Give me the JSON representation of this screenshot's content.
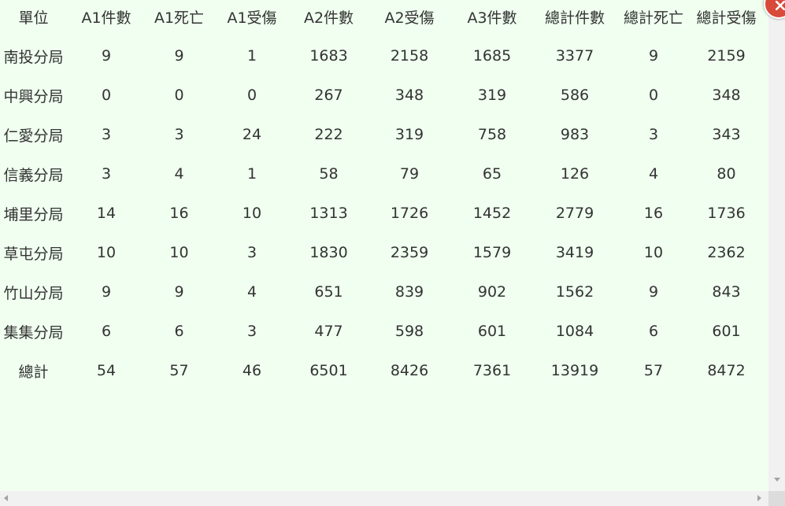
{
  "table": {
    "headers": [
      "單位",
      "A1件數",
      "A1死亡",
      "A1受傷",
      "A2件數",
      "A2受傷",
      "A3件數",
      "總計件數",
      "總計死亡",
      "總計受傷"
    ],
    "rows": [
      [
        "南投分局",
        "9",
        "9",
        "1",
        "1683",
        "2158",
        "1685",
        "3377",
        "9",
        "2159"
      ],
      [
        "中興分局",
        "0",
        "0",
        "0",
        "267",
        "348",
        "319",
        "586",
        "0",
        "348"
      ],
      [
        "仁愛分局",
        "3",
        "3",
        "24",
        "222",
        "319",
        "758",
        "983",
        "3",
        "343"
      ],
      [
        "信義分局",
        "3",
        "4",
        "1",
        "58",
        "79",
        "65",
        "126",
        "4",
        "80"
      ],
      [
        "埔里分局",
        "14",
        "16",
        "10",
        "1313",
        "1726",
        "1452",
        "2779",
        "16",
        "1736"
      ],
      [
        "草屯分局",
        "10",
        "10",
        "3",
        "1830",
        "2359",
        "1579",
        "3419",
        "10",
        "2362"
      ],
      [
        "竹山分局",
        "9",
        "9",
        "4",
        "651",
        "839",
        "902",
        "1562",
        "9",
        "843"
      ],
      [
        "集集分局",
        "6",
        "6",
        "3",
        "477",
        "598",
        "601",
        "1084",
        "6",
        "601"
      ],
      [
        "總計",
        "54",
        "57",
        "46",
        "6501",
        "8426",
        "7361",
        "13919",
        "57",
        "8472"
      ]
    ]
  },
  "close_button": {
    "icon": "close-icon"
  },
  "scrollbar": {
    "down_icon": "chevron-down-icon",
    "left_icon": "chevron-left-icon",
    "right_icon": "chevron-right-icon"
  },
  "colors": {
    "background": "#f0fff0",
    "text": "#333333",
    "close_button": "#d84a3a"
  }
}
